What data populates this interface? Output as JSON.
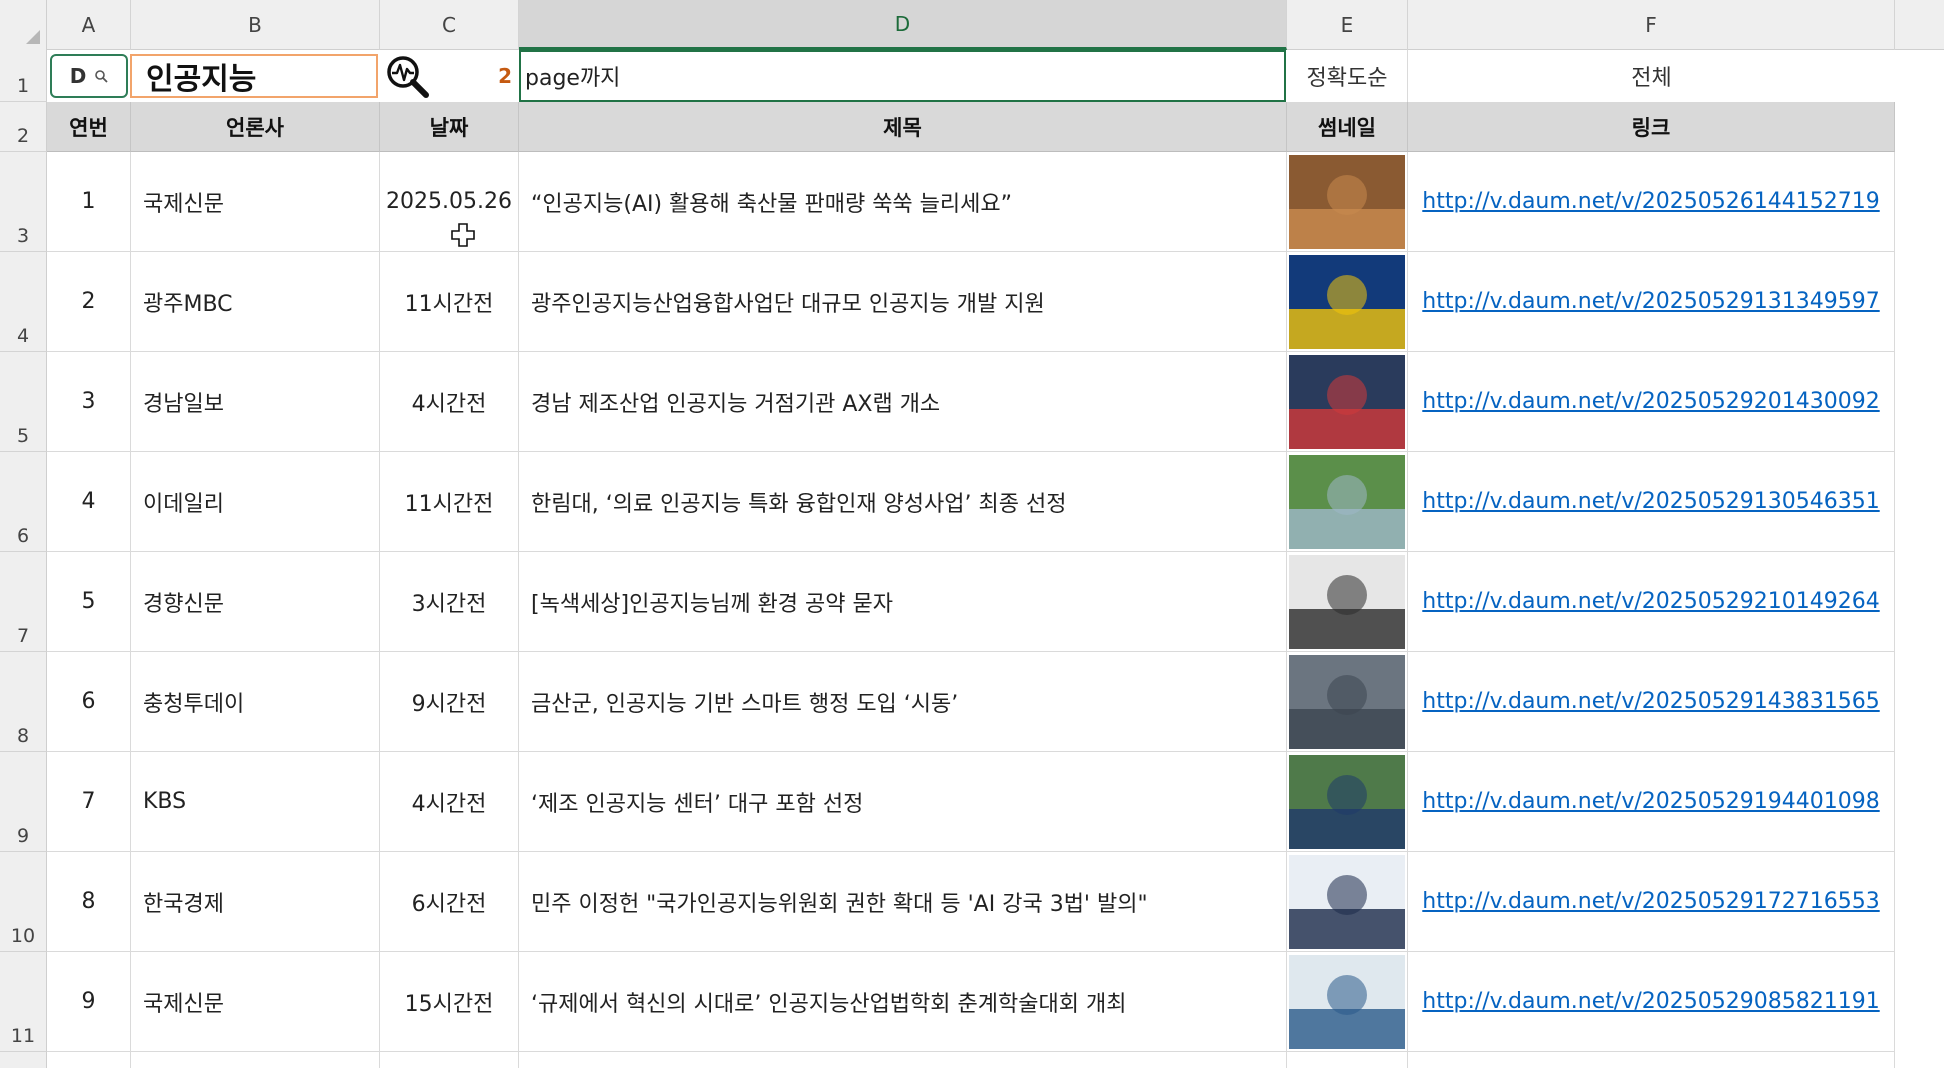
{
  "columns": [
    "A",
    "B",
    "C",
    "D",
    "E",
    "F"
  ],
  "rows_numbers": [
    "1",
    "2",
    "3",
    "4",
    "5",
    "6",
    "7",
    "8",
    "9",
    "10",
    "11"
  ],
  "toolbar": {
    "dropdown_label": "D",
    "keyword": "인공지능",
    "page_count": "2",
    "page_suffix": "page까지",
    "sort": "정확도순",
    "scope": "전체"
  },
  "headers": {
    "no": "연번",
    "press": "언론사",
    "date": "날짜",
    "title": "제목",
    "thumb": "썸네일",
    "link": "링크"
  },
  "articles": [
    {
      "no": "1",
      "press": "국제신문",
      "date": "2025.05.26",
      "title": "“인공지능(AI) 활용해 축산물 판매량 쑥쑥 늘리세요”",
      "link": "http://v.daum.net/v/20250526144152719",
      "thumb_color": "#8a5a32",
      "thumb_color2": "#c98b4f"
    },
    {
      "no": "2",
      "press": "광주MBC",
      "date": "11시간전",
      "title": "광주인공지능산업융합사업단 대규모 인공지능 개발 지원",
      "link": "http://v.daum.net/v/20250529131349597",
      "thumb_color": "#123a7a",
      "thumb_color2": "#f2c40a"
    },
    {
      "no": "3",
      "press": "경남일보",
      "date": "4시간전",
      "title": "경남 제조산업 인공지능 거점기관 AX랩 개소",
      "link": "http://v.daum.net/v/20250529201430092",
      "thumb_color": "#2a3b5c",
      "thumb_color2": "#d23a3a"
    },
    {
      "no": "4",
      "press": "이데일리",
      "date": "11시간전",
      "title": "한림대, ‘의료 인공지능 특화 융합인재 양성사업’ 최종 선정",
      "link": "http://v.daum.net/v/20250529130546351",
      "thumb_color": "#5b8f4a",
      "thumb_color2": "#9fb8c9"
    },
    {
      "no": "5",
      "press": "경향신문",
      "date": "3시간전",
      "title": "[녹색세상]인공지능님께 환경 공약 묻자",
      "link": "http://v.daum.net/v/20250529210149264",
      "thumb_color": "#e6e6e6",
      "thumb_color2": "#2b2b2b"
    },
    {
      "no": "6",
      "press": "충청투데이",
      "date": "9시간전",
      "title": "금산군, 인공지능 기반 스마트 행정 도입 ‘시동’",
      "link": "http://v.daum.net/v/20250529143831565",
      "thumb_color": "#6b7580",
      "thumb_color2": "#3c4650"
    },
    {
      "no": "7",
      "press": "KBS",
      "date": "4시간전",
      "title": "‘제조 인공지능 센터’ 대구 포함 선정",
      "link": "http://v.daum.net/v/20250529194401098",
      "thumb_color": "#4f7a4a",
      "thumb_color2": "#1f3a6a"
    },
    {
      "no": "8",
      "press": "한국경제",
      "date": "6시간전",
      "title": "민주 이정헌 \"국가인공지능위원회 권한 확대 등 'AI 강국 3법' 발의\"",
      "link": "http://v.daum.net/v/20250529172716553",
      "thumb_color": "#e9eef4",
      "thumb_color2": "#1b2a4a"
    },
    {
      "no": "9",
      "press": "국제신문",
      "date": "15시간전",
      "title": "‘규제에서 혁신의 시대로’ 인공지능산업법학회 춘계학술대회 개최",
      "link": "http://v.daum.net/v/20250529085821191",
      "thumb_color": "#dfe8ee",
      "thumb_color2": "#2a5a8a"
    }
  ],
  "icons": [
    "search-small-icon",
    "magnifier-chart-icon",
    "select-all-triangle-icon",
    "move-cursor-icon"
  ]
}
